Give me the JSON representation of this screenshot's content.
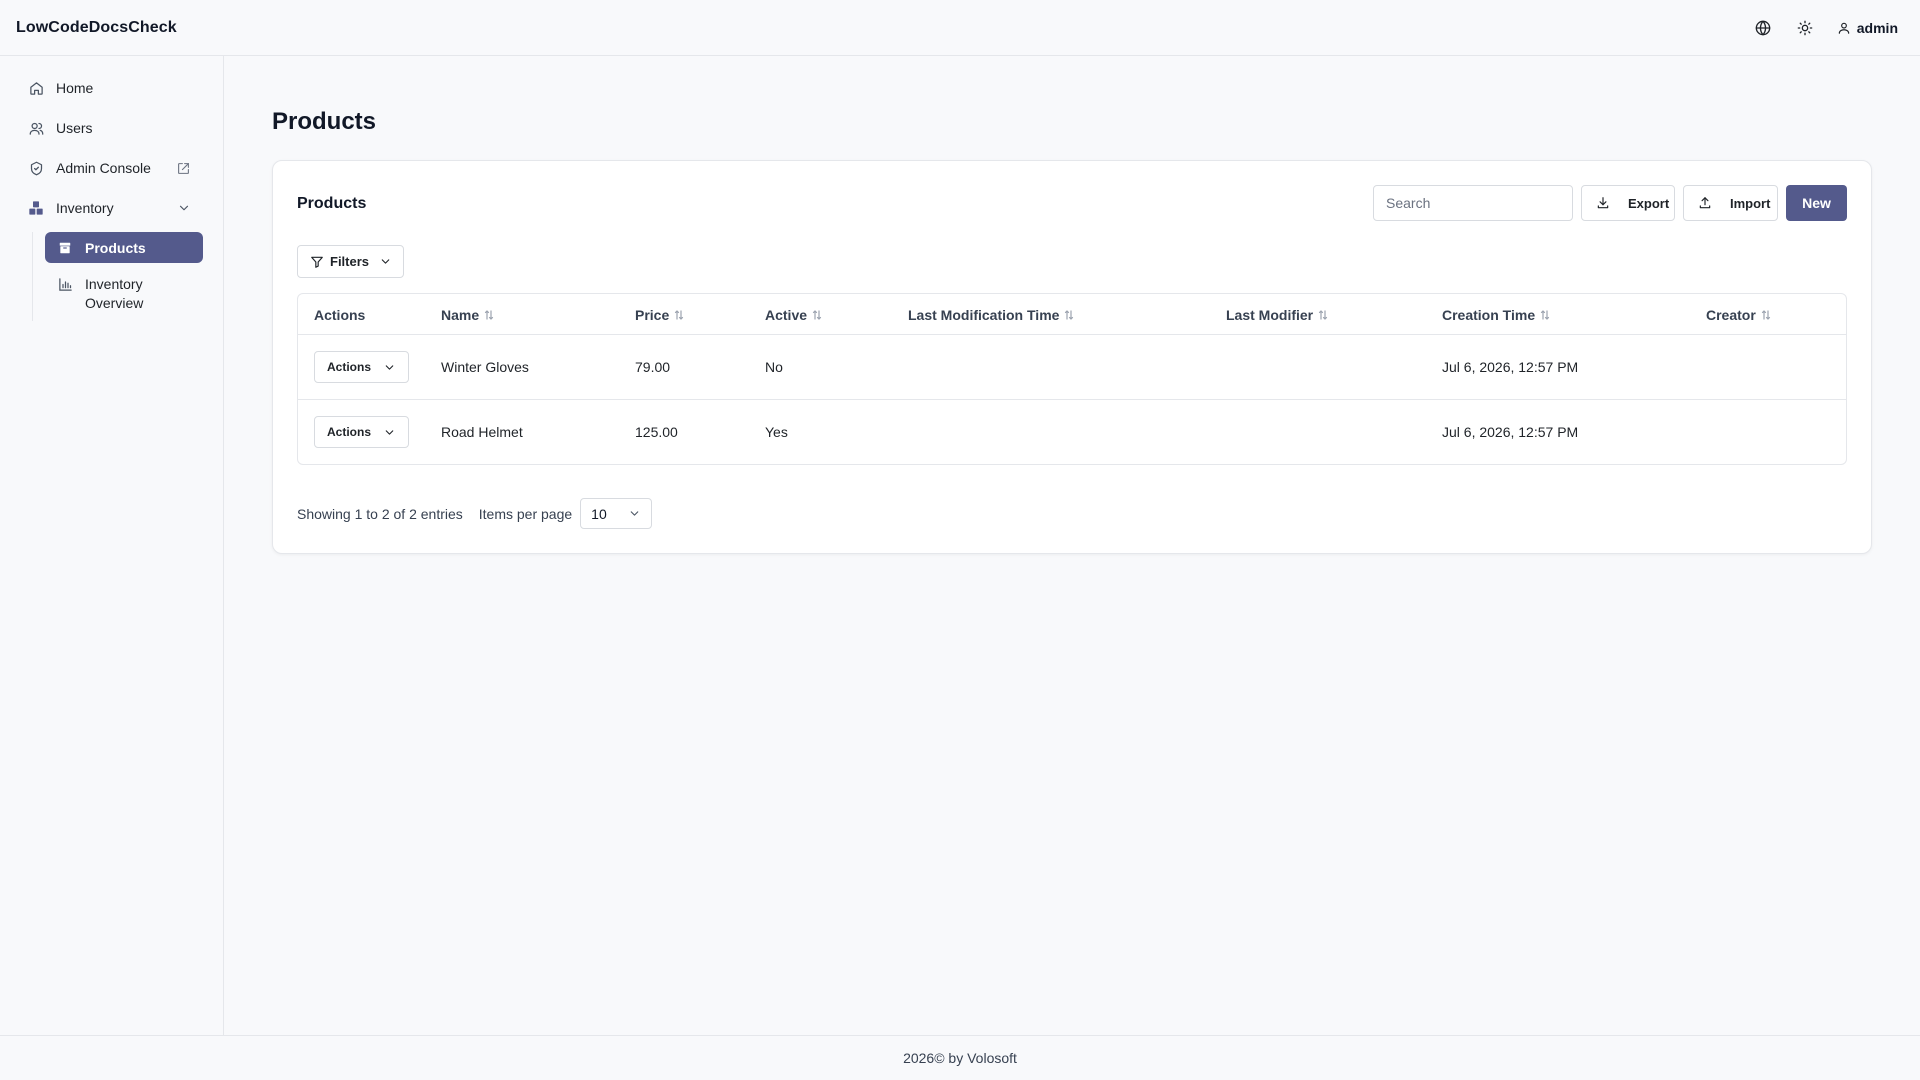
{
  "app": {
    "title": "LowCodeDocsCheck"
  },
  "topbar": {
    "language_icon": "globe-icon",
    "theme_icon": "sun-icon",
    "user_icon": "user-icon",
    "user_name": "admin"
  },
  "sidebar": {
    "items": [
      {
        "label": "Home",
        "icon": "home-icon"
      },
      {
        "label": "Users",
        "icon": "users-icon"
      },
      {
        "label": "Admin Console",
        "icon": "shield-icon"
      },
      {
        "label": "Inventory",
        "icon": "inventory-icon"
      }
    ],
    "subitems": [
      {
        "label": "Products",
        "icon": "box-icon",
        "active": true
      },
      {
        "label_line1": "Inventory",
        "label_line2": "Overview",
        "icon": "chart-icon"
      }
    ]
  },
  "main": {
    "page_title": "Products",
    "card": {
      "title": "Products",
      "search_placeholder": "Search",
      "export_label": "Export",
      "import_label": "Import",
      "new_label": "New",
      "filters_label": "Filters"
    },
    "table": {
      "columns": [
        "Actions",
        "Name",
        "Price",
        "Active",
        "Last Modification Time",
        "Last Modifier",
        "Creation Time",
        "Creator"
      ],
      "rows": [
        {
          "action": "Actions",
          "name": "Winter Gloves",
          "price": "79.00",
          "active": "No",
          "last_mod_time": "",
          "last_modifier": "",
          "creation_time": "Jul 6, 2026, 12:57 PM",
          "creator": ""
        },
        {
          "action": "Actions",
          "name": "Road Helmet",
          "price": "125.00",
          "active": "Yes",
          "last_mod_time": "",
          "last_modifier": "",
          "creation_time": "Jul 6, 2026, 12:57 PM",
          "creator": ""
        }
      ]
    },
    "pager": {
      "showing": "Showing 1 to 2 of 2 entries",
      "items_per_page_label": "Items per page",
      "page_size": "10"
    }
  },
  "footer": {
    "text": "2026© by Volosoft"
  },
  "colors": {
    "accent": "#545a8c",
    "border": "#e5e7eb",
    "background": "#f8f9fb"
  }
}
